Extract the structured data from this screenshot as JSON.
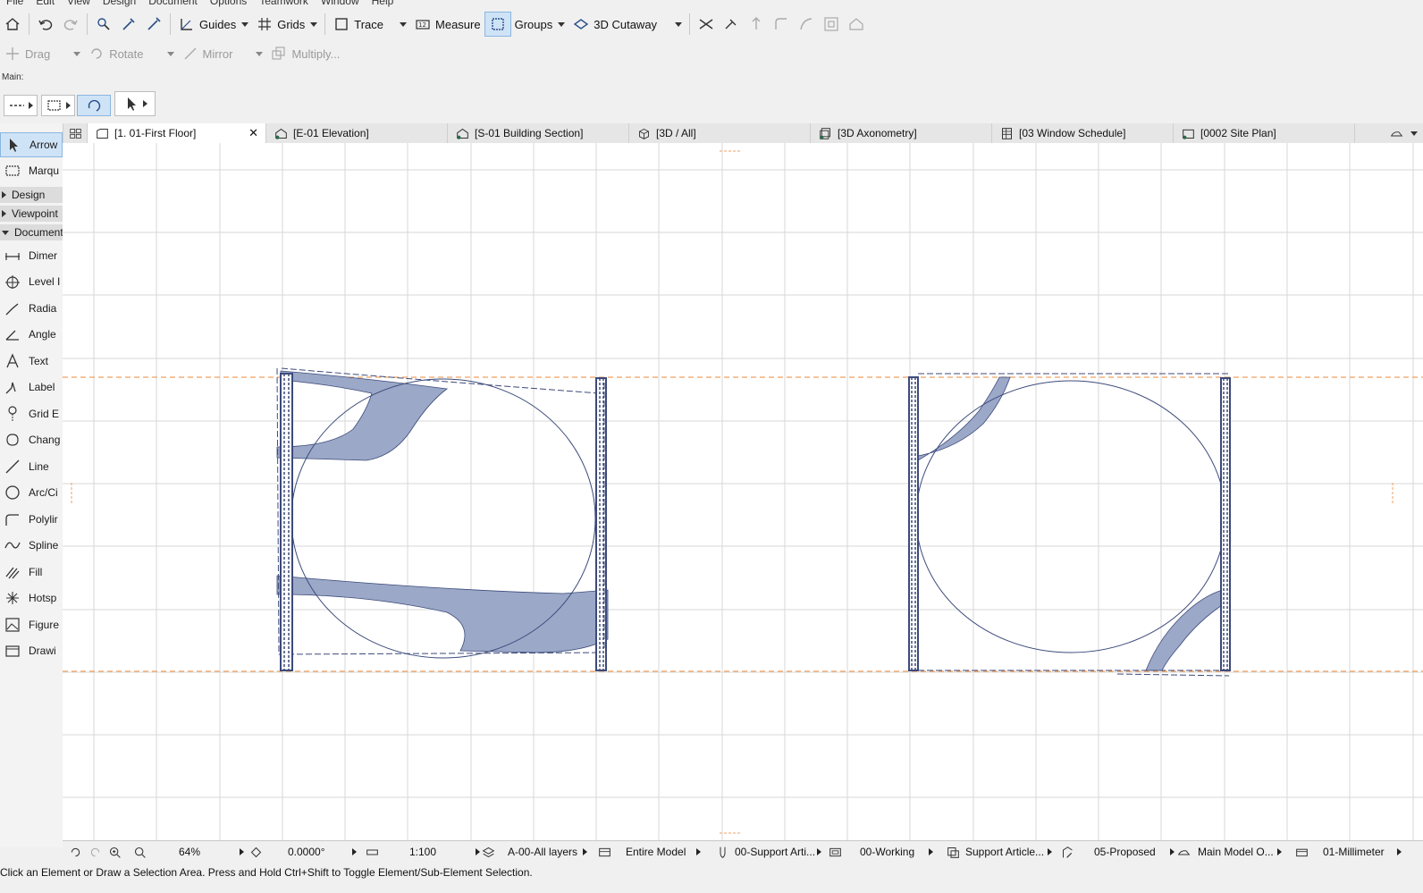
{
  "menu": [
    "File",
    "Edit",
    "View",
    "Design",
    "Document",
    "Options",
    "Teamwork",
    "Window",
    "Help"
  ],
  "toolbar1": {
    "guides": "Guides",
    "grids": "Grids",
    "trace": "Trace",
    "measure": "Measure",
    "groups": "Groups",
    "cutaway": "3D Cutaway"
  },
  "toolbar2": {
    "drag": "Drag",
    "rotate": "Rotate",
    "mirror": "Mirror",
    "multiply": "Multiply..."
  },
  "main_label": "Main:",
  "tabs": [
    {
      "label": "[1. 01-First Floor]",
      "icon": "floor-plan-icon",
      "active": true
    },
    {
      "label": "[E-01 Elevation]",
      "icon": "elevation-icon"
    },
    {
      "label": "[S-01 Building Section]",
      "icon": "section-icon"
    },
    {
      "label": "[3D / All]",
      "icon": "3d-cube-icon"
    },
    {
      "label": "[3D Axonometry]",
      "icon": "axonometry-icon"
    },
    {
      "label": "[03 Window Schedule]",
      "icon": "schedule-icon"
    },
    {
      "label": "[0002 Site Plan]",
      "icon": "site-plan-icon"
    }
  ],
  "toolbox": {
    "arrow": "Arrow",
    "marquee": "Marqu",
    "sections": {
      "design": "Design",
      "viewpoint": "Viewpoint",
      "document": "Document"
    },
    "document_tools": [
      "Dimer",
      "Level I",
      "Radia",
      "Angle",
      "Text",
      "Label",
      "Grid E",
      "Chang",
      "Line",
      "Arc/Ci",
      "Polylir",
      "Spline",
      "Fill",
      "Hotsp",
      "Figure",
      "Drawi"
    ]
  },
  "statusbar": {
    "zoom": "64%",
    "angle": "0.0000°",
    "scale": "1:100",
    "layers": "A-00-All layers",
    "model": "Entire Model",
    "pen_set": "00-Support Arti...",
    "mvo": "00-Working",
    "graphic_override": "Support Article...",
    "renovation": "05-Proposed",
    "structure": "Main Model O...",
    "dimension": "01-Millimeter"
  },
  "message": "Click an Element or Draw a Selection Area. Press and Hold Ctrl+Shift to Toggle Element/Sub-Element Selection.",
  "colors": {
    "accent": "#cfe3f7",
    "wall": "#3c4a7a",
    "fill": "#9ba8c8",
    "guide": "#f0a060",
    "grid": "#d7d7d7"
  }
}
